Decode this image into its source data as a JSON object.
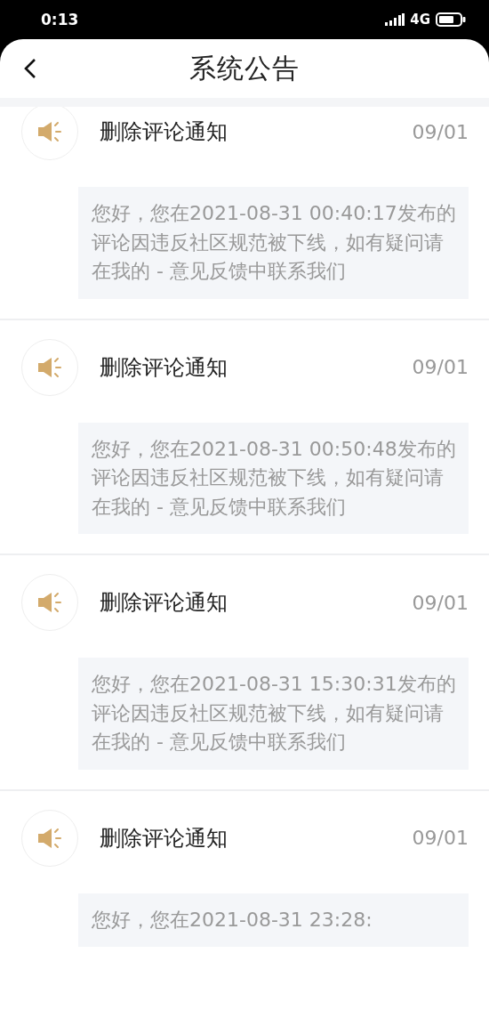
{
  "status_bar": {
    "time": "0:13",
    "network": "4G"
  },
  "header": {
    "title": "系统公告"
  },
  "notices": [
    {
      "title": "删除评论通知",
      "date": "09/01",
      "message": "您好，您在2021-08-31 00:40:17发布的评论因违反社区规范被下线，如有疑问请在我的 - 意见反馈中联系我们"
    },
    {
      "title": "删除评论通知",
      "date": "09/01",
      "message": "您好，您在2021-08-31 00:50:48发布的评论因违反社区规范被下线，如有疑问请在我的 - 意见反馈中联系我们"
    },
    {
      "title": "删除评论通知",
      "date": "09/01",
      "message": "您好，您在2021-08-31 15:30:31发布的评论因违反社区规范被下线，如有疑问请在我的 - 意见反馈中联系我们"
    },
    {
      "title": "删除评论通知",
      "date": "09/01",
      "message": "您好，您在2021-08-31 23:28:"
    }
  ]
}
